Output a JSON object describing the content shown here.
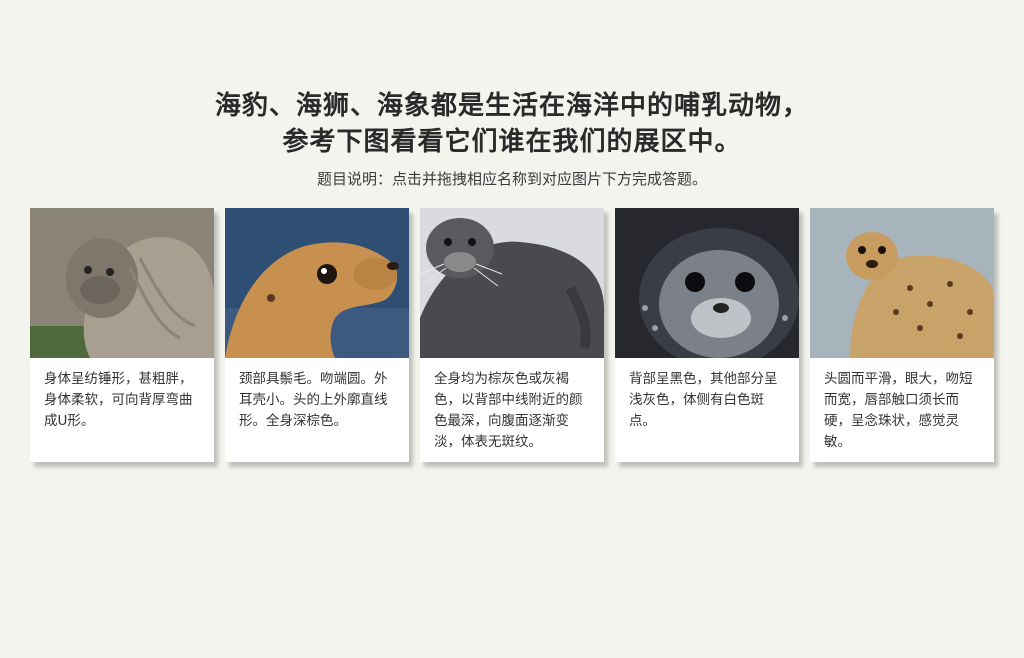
{
  "title_line1": "海豹、海狮、海象都是生活在海洋中的哺乳动物，",
  "title_line2": "参考下图看看它们谁在我们的展区中。",
  "instruction": "题目说明：点击并拖拽相应名称到对应图片下方完成答题。",
  "cards": [
    {
      "image": "elephant-seal-photo",
      "description": "身体呈纺锤形，甚粗胖，身体柔软，可向背厚弯曲成U形。"
    },
    {
      "image": "sea-lion-photo",
      "description": "颈部具鬃毛。吻端圆。外耳壳小。头的上外廓直线形。全身深棕色。"
    },
    {
      "image": "bearded-seal-photo",
      "description": "全身均为棕灰色或灰褐色，以背部中线附近的颜色最深，向腹面逐渐变淡，体表无斑纹。"
    },
    {
      "image": "ringed-seal-photo",
      "description": "背部呈黑色，其他部分呈浅灰色，体侧有白色斑点。"
    },
    {
      "image": "harbor-seal-photo",
      "description": "头圆而平滑，眼大，吻短而宽，唇部触口须长而硬，呈念珠状，感觉灵敏。"
    }
  ]
}
